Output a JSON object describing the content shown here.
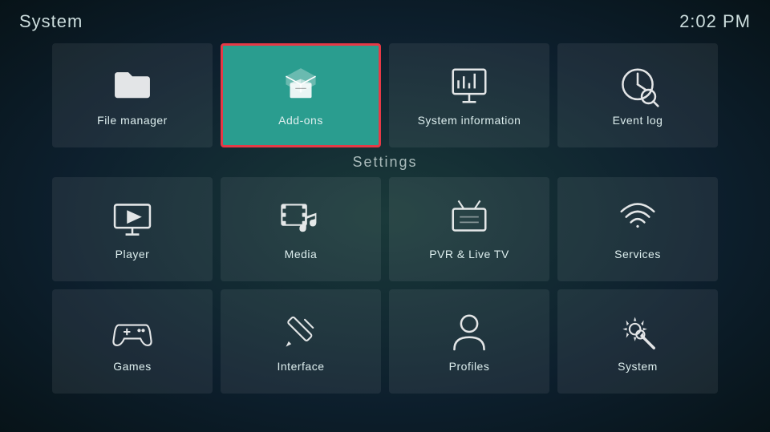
{
  "header": {
    "title": "System",
    "time": "2:02 PM"
  },
  "top_section": {
    "tiles": [
      {
        "id": "file-manager",
        "label": "File manager",
        "selected": false
      },
      {
        "id": "add-ons",
        "label": "Add-ons",
        "selected": true
      },
      {
        "id": "system-information",
        "label": "System information",
        "selected": false
      },
      {
        "id": "event-log",
        "label": "Event log",
        "selected": false
      }
    ]
  },
  "settings_label": "Settings",
  "settings_row1": [
    {
      "id": "player",
      "label": "Player"
    },
    {
      "id": "media",
      "label": "Media"
    },
    {
      "id": "pvr-live-tv",
      "label": "PVR & Live TV"
    },
    {
      "id": "services",
      "label": "Services"
    }
  ],
  "settings_row2": [
    {
      "id": "games",
      "label": "Games"
    },
    {
      "id": "interface",
      "label": "Interface"
    },
    {
      "id": "profiles",
      "label": "Profiles"
    },
    {
      "id": "system",
      "label": "System"
    }
  ]
}
